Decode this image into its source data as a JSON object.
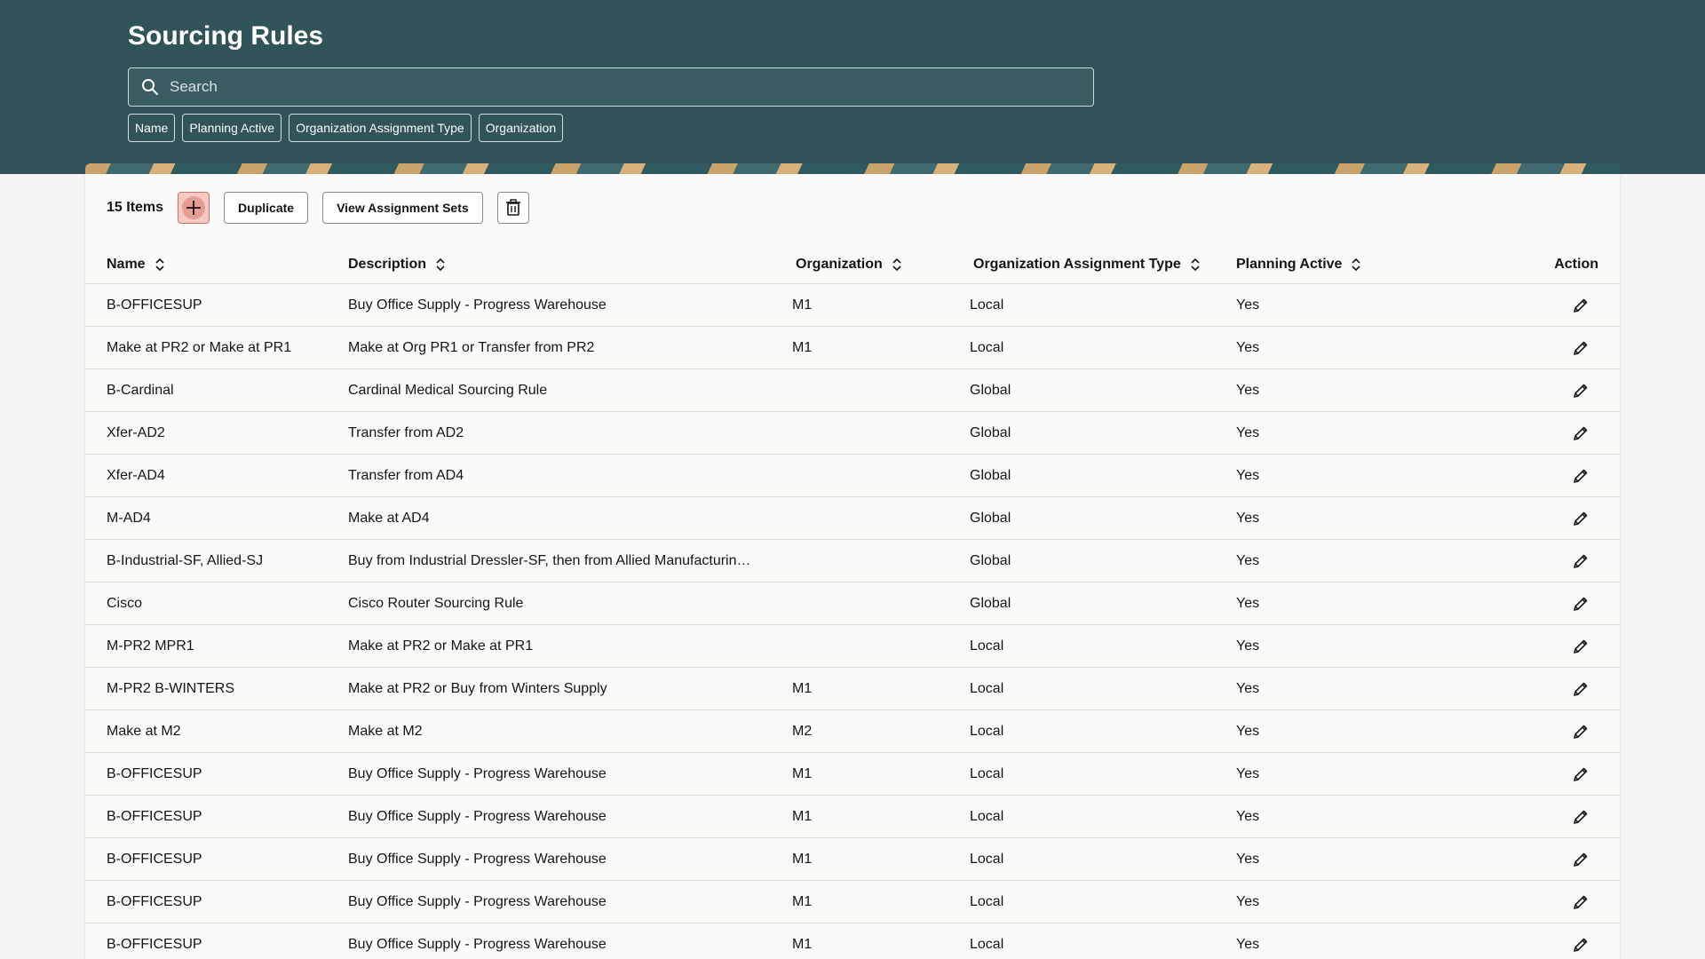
{
  "header": {
    "title": "Sourcing Rules",
    "search_placeholder": "Search",
    "filters": [
      "Name",
      "Planning Active",
      "Organization Assignment Type",
      "Organization"
    ]
  },
  "toolbar": {
    "items_count": "15 Items",
    "duplicate_label": "Duplicate",
    "view_assignment_sets_label": "View Assignment Sets"
  },
  "table": {
    "columns": {
      "name": "Name",
      "description": "Description",
      "organization": "Organization",
      "assignment_type": "Organization Assignment Type",
      "planning_active": "Planning Active",
      "action": "Action"
    },
    "rows": [
      {
        "name": "B-OFFICESUP",
        "description": "Buy Office Supply - Progress Warehouse",
        "organization": "M1",
        "assignment_type": "Local",
        "planning_active": "Yes"
      },
      {
        "name": "Make at PR2 or Make at PR1",
        "description": "Make at Org PR1 or Transfer from PR2",
        "organization": "M1",
        "assignment_type": "Local",
        "planning_active": "Yes"
      },
      {
        "name": "B-Cardinal",
        "description": "Cardinal Medical Sourcing Rule",
        "organization": "",
        "assignment_type": "Global",
        "planning_active": "Yes"
      },
      {
        "name": "Xfer-AD2",
        "description": "Transfer from AD2",
        "organization": "",
        "assignment_type": "Global",
        "planning_active": "Yes"
      },
      {
        "name": "Xfer-AD4",
        "description": "Transfer from AD4",
        "organization": "",
        "assignment_type": "Global",
        "planning_active": "Yes"
      },
      {
        "name": "M-AD4",
        "description": "Make at AD4",
        "organization": "",
        "assignment_type": "Global",
        "planning_active": "Yes"
      },
      {
        "name": "B-Industrial-SF, Allied-SJ",
        "description": "Buy from Industrial Dressler-SF, then from Allied Manufacturin…",
        "organization": "",
        "assignment_type": "Global",
        "planning_active": "Yes"
      },
      {
        "name": "Cisco",
        "description": "Cisco Router Sourcing Rule",
        "organization": "",
        "assignment_type": "Global",
        "planning_active": "Yes"
      },
      {
        "name": "M-PR2 MPR1",
        "description": "Make at PR2 or Make at PR1",
        "organization": "",
        "assignment_type": "Local",
        "planning_active": "Yes"
      },
      {
        "name": "M-PR2 B-WINTERS",
        "description": "Make at PR2 or Buy from Winters Supply",
        "organization": "M1",
        "assignment_type": "Local",
        "planning_active": "Yes"
      },
      {
        "name": "Make at M2",
        "description": "Make at M2",
        "organization": "M2",
        "assignment_type": "Local",
        "planning_active": "Yes"
      },
      {
        "name": "B-OFFICESUP",
        "description": "Buy Office Supply - Progress Warehouse",
        "organization": "M1",
        "assignment_type": "Local",
        "planning_active": "Yes"
      },
      {
        "name": "B-OFFICESUP",
        "description": "Buy Office Supply - Progress Warehouse",
        "organization": "M1",
        "assignment_type": "Local",
        "planning_active": "Yes"
      },
      {
        "name": "B-OFFICESUP",
        "description": "Buy Office Supply - Progress Warehouse",
        "organization": "M1",
        "assignment_type": "Local",
        "planning_active": "Yes"
      },
      {
        "name": "B-OFFICESUP",
        "description": "Buy Office Supply - Progress Warehouse",
        "organization": "M1",
        "assignment_type": "Local",
        "planning_active": "Yes"
      },
      {
        "name": "B-OFFICESUP",
        "description": "Buy Office Supply - Progress Warehouse",
        "organization": "M1",
        "assignment_type": "Local",
        "planning_active": "Yes"
      }
    ]
  },
  "icons": {
    "search": "search-icon",
    "sort": "sort-icon",
    "edit": "pencil-icon",
    "add": "plus-icon",
    "delete": "trash-icon"
  }
}
